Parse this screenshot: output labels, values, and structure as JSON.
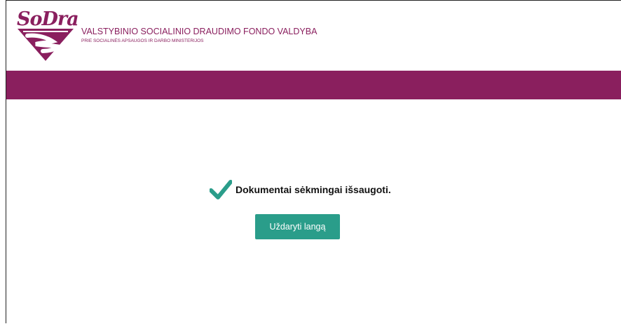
{
  "header": {
    "logo_text": "SoDra",
    "org_title": "VALSTYBINIO SOCIALINIO DRAUDIMO FONDO VALDYBA",
    "org_subtitle": "PRIE SOCIALINĖS APSAUGOS IR DARBO MINISTERIJOS"
  },
  "colors": {
    "brand": "#8a1f5e",
    "button": "#2a9d8a",
    "check": "#2a9d8a"
  },
  "main": {
    "status_icon": "checkmark-icon",
    "message": "Dokumentai sėkmingai išsaugoti.",
    "close_button_label": "Uždaryti langą"
  }
}
